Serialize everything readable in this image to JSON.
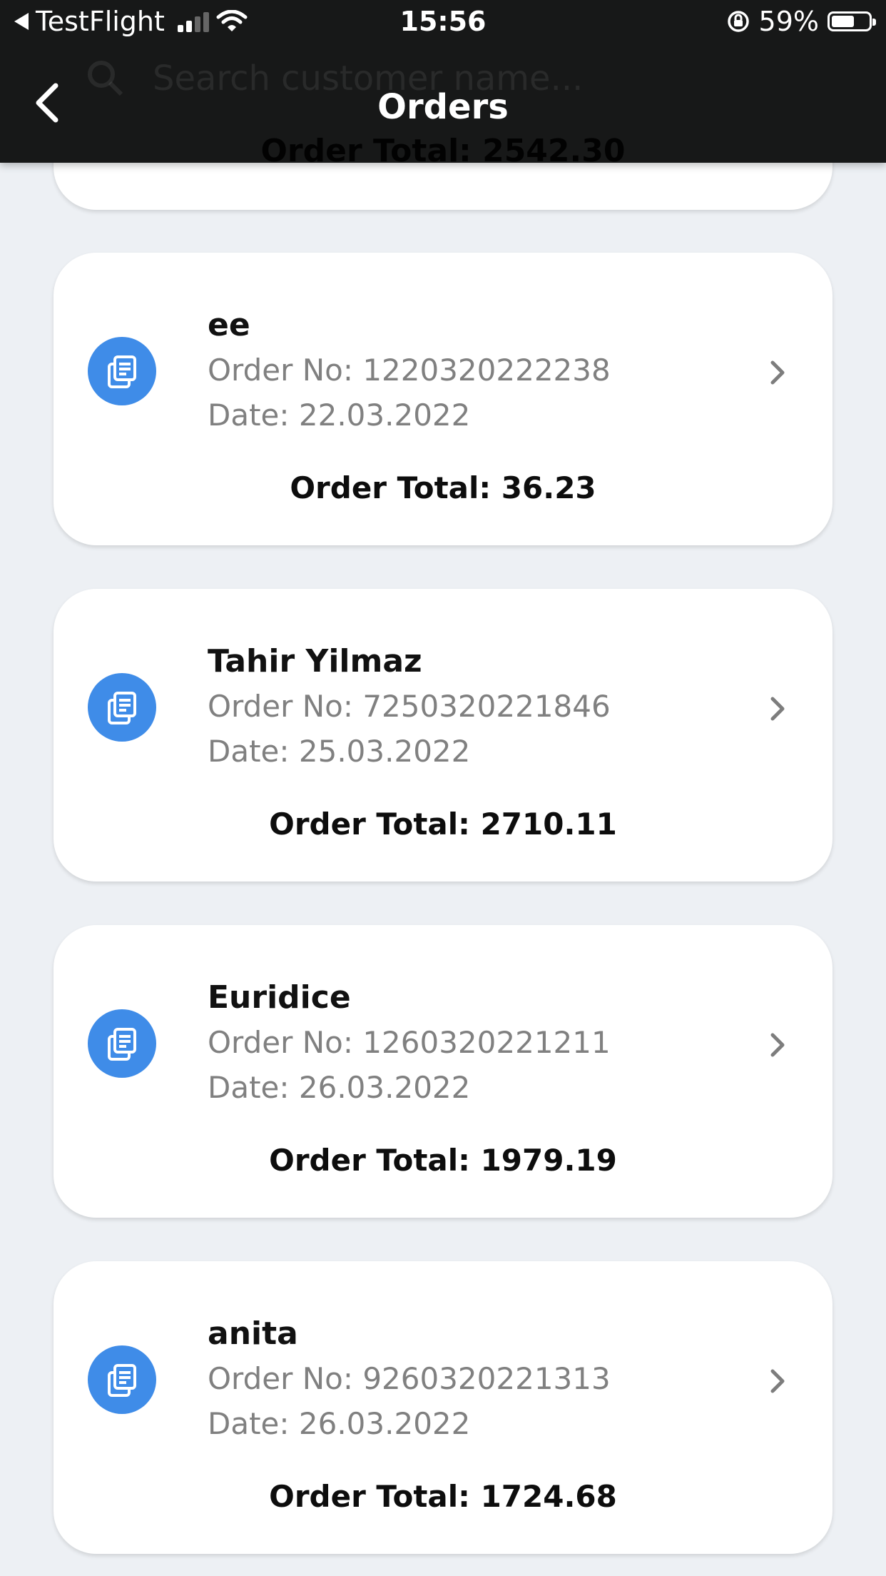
{
  "status_bar": {
    "back_app": "TestFlight",
    "time": "15:56",
    "battery": "59%",
    "battery_level": 0.59
  },
  "nav": {
    "title": "Orders",
    "search_placeholder": "Search customer name...",
    "hidden_total": "Order Total: 2542.30"
  },
  "orders": [
    {
      "name": "ee",
      "order_no": "Order No: 1220320222238",
      "date": "Date: 22.03.2022",
      "total": "Order Total: 36.23"
    },
    {
      "name": "Tahir Yilmaz",
      "order_no": "Order No: 7250320221846",
      "date": "Date: 25.03.2022",
      "total": "Order Total: 2710.11"
    },
    {
      "name": "Euridice",
      "order_no": "Order No: 1260320221211",
      "date": "Date: 26.03.2022",
      "total": "Order Total: 1979.19"
    },
    {
      "name": "anita",
      "order_no": "Order No: 9260320221313",
      "date": "Date: 26.03.2022",
      "total": "Order Total: 1724.68"
    }
  ],
  "icons": {
    "order": "document-list-icon",
    "row_action": "chevron-right-icon",
    "back": "chevron-left-icon",
    "search": "search-icon"
  },
  "colors": {
    "accent": "#3f8ce8",
    "background": "#edf0f4",
    "header": "#171818"
  }
}
